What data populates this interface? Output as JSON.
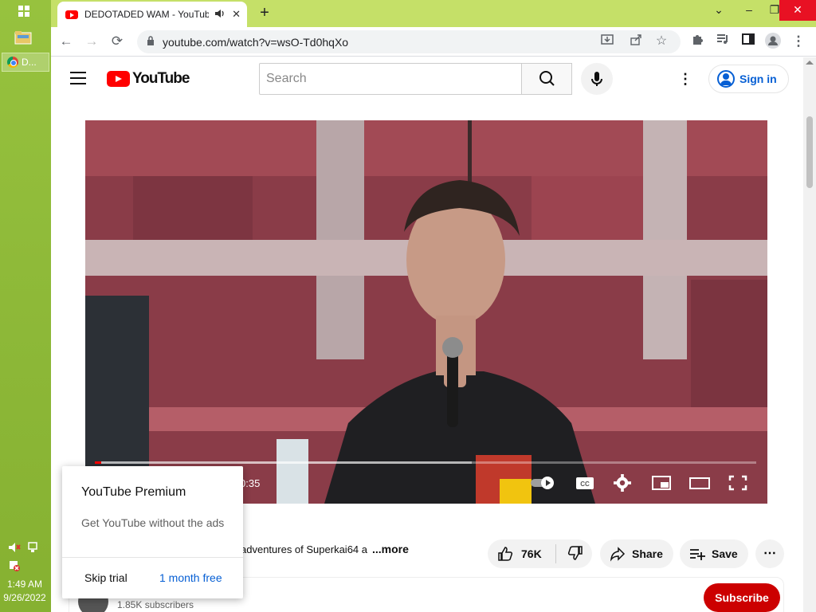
{
  "desktop": {
    "taskbar_item_label": "D...",
    "clock_time": "1:49 AM",
    "clock_date": "9/26/2022"
  },
  "browser": {
    "tab_title": "DEDOTADED WAM - YouTube",
    "url": "youtube.com/watch?v=wsO-Td0hqXo",
    "colors": {
      "tabstrip": "#c5e068",
      "close_hover": "#e81123"
    }
  },
  "youtube": {
    "search_placeholder": "Search",
    "signin_label": "Sign in",
    "player": {
      "time_display": "0:35",
      "progress_played_fraction": 0.01,
      "progress_loaded_fraction": 0.57
    },
    "description_snippet": "adventures of Superkai64 a",
    "description_more": "...more",
    "actions": {
      "like_count": "76K",
      "share_label": "Share",
      "save_label": "Save"
    },
    "channel": {
      "subscribers": "1.85K subscribers",
      "subscribe_label": "Subscribe"
    },
    "premium_popup": {
      "title": "YouTube Premium",
      "subtitle": "Get YouTube without the ads",
      "skip_label": "Skip trial",
      "cta_label": "1 month free"
    },
    "colors": {
      "brand_red": "#ff0000",
      "link_blue": "#065fd4",
      "subscribe_red": "#cc0000"
    }
  }
}
